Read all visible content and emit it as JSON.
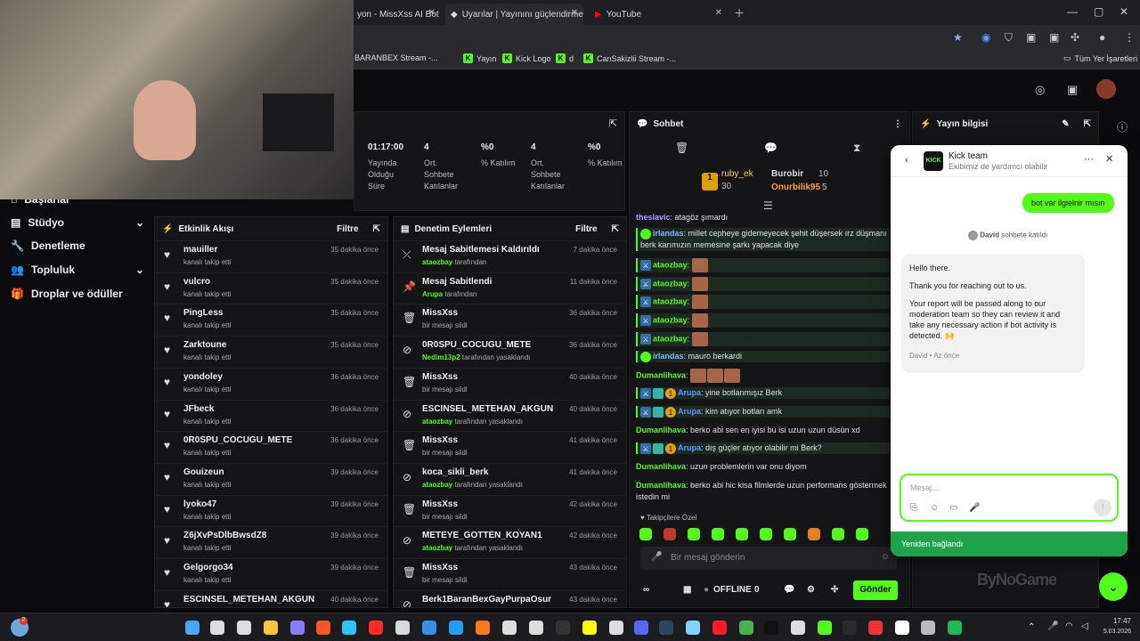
{
  "browser": {
    "tabs": [
      {
        "label": "yon - MissXss AI Bot S"
      },
      {
        "label": "Uyarılar | Yayınını güçlendirme"
      },
      {
        "label": "YouTube"
      }
    ],
    "bookmarks": [
      "BARANBEX Stream -...",
      "Yayın",
      "Kick Logo",
      "d",
      "CanSakizlii Stream -..."
    ],
    "all_bookmarks": "Tüm Yer İşaretleri"
  },
  "sidebar": {
    "items": [
      {
        "label": "Başlarlar",
        "icon": "home-icon"
      },
      {
        "label": "Stüdyo",
        "icon": "studio-icon"
      },
      {
        "label": "Denetleme",
        "icon": "wrench-icon"
      },
      {
        "label": "Topluluk",
        "icon": "users-icon"
      },
      {
        "label": "Droplar ve ödüller",
        "icon": "gift-icon"
      }
    ]
  },
  "stats": [
    {
      "value": "01:17:00",
      "label": "Yayında Olduğu Süre"
    },
    {
      "value": "4",
      "label": "Ort. Sohbete Katılanlar"
    },
    {
      "value": "%0",
      "label": "% Katılım"
    },
    {
      "value": "4",
      "label": "Ort. Sohbete Katılanlar"
    },
    {
      "value": "%0",
      "label": "% Katılım"
    }
  ],
  "activity": {
    "title": "Etkinlik Akışı",
    "filter": "Filtre",
    "rows": [
      {
        "name": "mauiller",
        "sub": "kanalı takip etti",
        "time": "35 dakika önce"
      },
      {
        "name": "vulcro",
        "sub": "kanalı takip etti",
        "time": "35 dakika önce"
      },
      {
        "name": "PingLess",
        "sub": "kanalı takip etti",
        "time": "35 dakika önce"
      },
      {
        "name": "Zarktoune",
        "sub": "kanalı takip etti",
        "time": "35 dakika önce"
      },
      {
        "name": "yondoley",
        "sub": "kanalı takip etti",
        "time": "36 dakika önce"
      },
      {
        "name": "JFbeck",
        "sub": "kanalı takip etti",
        "time": "36 dakika önce"
      },
      {
        "name": "0R0SPU_COCUGU_METE",
        "sub": "kanalı takip etti",
        "time": "36 dakika önce"
      },
      {
        "name": "Gouizeun",
        "sub": "kanalı takip etti",
        "time": "39 dakika önce"
      },
      {
        "name": "lyoko47",
        "sub": "kanalı takip etti",
        "time": "39 dakika önce"
      },
      {
        "name": "Z6jXvPsDlbBwsdZ8",
        "sub": "kanalı takip etti",
        "time": "39 dakika önce"
      },
      {
        "name": "Gelgorgo34",
        "sub": "kanalı takip etti",
        "time": "39 dakika önce"
      },
      {
        "name": "ESCINSEL_METEHAN_AKGUN",
        "sub": "",
        "time": "40 dakika önce"
      }
    ]
  },
  "moderation": {
    "title": "Denetim Eylemleri",
    "filter": "Filtre",
    "rows": [
      {
        "name": "Mesaj Sabitlemesi Kaldırıldı",
        "actor": "ataozbay",
        "sub": " tarafından",
        "time": "7 dakika önce",
        "icon": "unpin-icon"
      },
      {
        "name": "Mesaj Sabitlendi",
        "actor": "Arupa",
        "sub": " tarafından",
        "time": "11 dakika önce",
        "icon": "pin-icon"
      },
      {
        "name": "MissXss",
        "actor": "",
        "sub": "bir mesajı sildi",
        "time": "36 dakika önce",
        "icon": "trash-icon"
      },
      {
        "name": "0R0SPU_COCUGU_METE",
        "actor": "Nedim13p2",
        "sub": " tarafından yasaklandı",
        "time": "36 dakika önce",
        "icon": "ban-icon"
      },
      {
        "name": "MissXss",
        "actor": "",
        "sub": "bir mesajı sildi",
        "time": "40 dakika önce",
        "icon": "trash-icon"
      },
      {
        "name": "ESCINSEL_METEHAN_AKGUN",
        "actor": "ataozbay",
        "sub": " tarafından yasaklandı",
        "time": "40 dakika önce",
        "icon": "ban-icon"
      },
      {
        "name": "MissXss",
        "actor": "",
        "sub": "bir mesajı sildi",
        "time": "41 dakika önce",
        "icon": "trash-icon"
      },
      {
        "name": "koca_sikli_berk",
        "actor": "ataozbay",
        "sub": " tarafından yasaklandı",
        "time": "41 dakika önce",
        "icon": "ban-icon"
      },
      {
        "name": "MissXss",
        "actor": "",
        "sub": "bir mesajı sildi",
        "time": "42 dakika önce",
        "icon": "trash-icon"
      },
      {
        "name": "METEYE_GOTTEN_KOYAN1",
        "actor": "ataozbay",
        "sub": " tarafından yasaklandı",
        "time": "42 dakika önce",
        "icon": "ban-icon"
      },
      {
        "name": "MissXss",
        "actor": "",
        "sub": "bir mesajı sildi",
        "time": "43 dakika önce",
        "icon": "trash-icon"
      },
      {
        "name": "Berk1BaranBexGayPurpaOsur",
        "actor": "",
        "sub": "",
        "time": "43 dakika önce",
        "icon": "ban-icon"
      }
    ]
  },
  "chat": {
    "title": "Sohbet",
    "leaders": [
      {
        "name": "ruby_ek",
        "count": "30"
      },
      {
        "name": "Burobir",
        "count": "10"
      },
      {
        "name": "Onurbilik95",
        "count": "5"
      }
    ],
    "messages": [
      {
        "user": "theslavic",
        "color": "#b59cff",
        "text": "atagöz şımardı"
      },
      {
        "user": "irlandas",
        "color": "#7fb6ff",
        "text": "millet cepheye gidemeyecek şehit düşersek ırz düşmanı berk karımızın memesine şarkı yapacak diye"
      },
      {
        "user": "ataozbay",
        "color": "#53fc18",
        "text": ""
      },
      {
        "user": "ataozbay",
        "color": "#53fc18",
        "text": ""
      },
      {
        "user": "ataozbay",
        "color": "#53fc18",
        "text": ""
      },
      {
        "user": "ataozbay",
        "color": "#53fc18",
        "text": ""
      },
      {
        "user": "ataozbay",
        "color": "#53fc18",
        "text": ""
      },
      {
        "user": "irlandas",
        "color": "#7fb6ff",
        "text": "mauro berkardi"
      },
      {
        "user": "Dumanlihava",
        "color": "#53fc18",
        "text": ""
      },
      {
        "user": "Arupa",
        "color": "#5a9cff",
        "text": "yine botlanmışız Berk"
      },
      {
        "user": "Arupa",
        "color": "#5a9cff",
        "text": "kim atıyor botları amk"
      },
      {
        "user": "Dumanlihava",
        "color": "#53fc18",
        "text": "berko abi sen en iyisi bu isi uzun uzun düsün xd"
      },
      {
        "user": "Arupa",
        "color": "#5a9cff",
        "text": "dış güçler atıyor olabilir mi Berk?"
      },
      {
        "user": "Dumanlihava",
        "color": "#53fc18",
        "text": "uzun problemlerin var onu diyom"
      },
      {
        "user": "Dumanlihava",
        "color": "#53fc18",
        "text": "berko abi hic kisa filmlerde uzun performans göstermek istedin mi"
      }
    ],
    "followers_only": "Takipçilere Özel",
    "input_placeholder": "Bir mesaj gönderin",
    "status": "OFFLINE",
    "viewer_count": "0",
    "send": "Gönder"
  },
  "stream_info": {
    "title": "Yayın bilgisi"
  },
  "help": {
    "team": "Kick team",
    "subtitle": "Ekibimiz de yardımcı olabilir",
    "user_msg": "bot var ilgielnir mısın",
    "joined_name": "David",
    "joined_text": " sohbete katıldı",
    "reply": [
      "Hello there.",
      "Thank you for reaching out to us.",
      "Your report will be passed along to our moderation team so they can review it and take any necessary action if bot activity is detected. 🙌"
    ],
    "meta": "David • Az önce",
    "input_placeholder": "Mesaj...",
    "reconnected": "Yeniden bağlandı"
  },
  "watermark": "ByNoGame",
  "clock": {
    "time": "17:47",
    "date": "5.03.2026"
  },
  "colors": {
    "kick_green": "#53fc18",
    "panel": "#151518"
  }
}
